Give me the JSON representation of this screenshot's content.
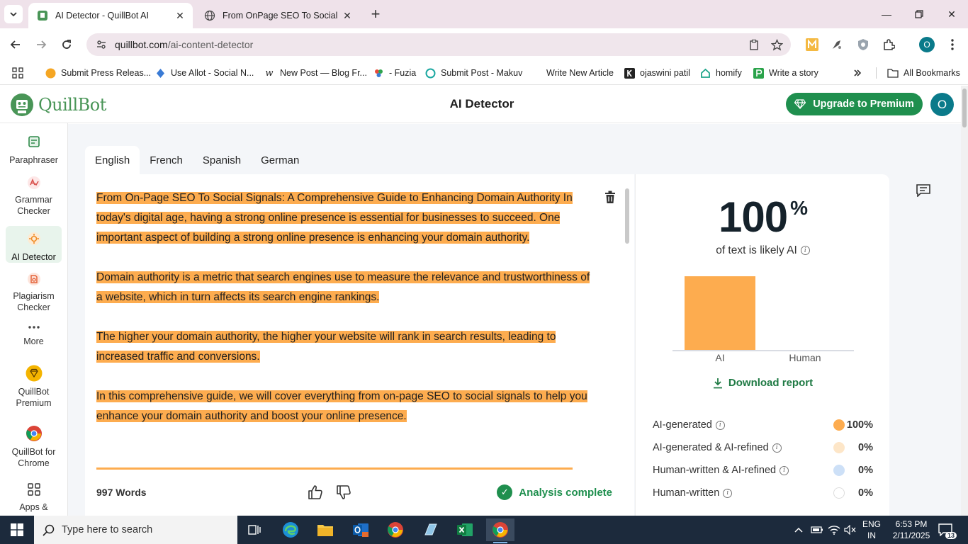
{
  "browser": {
    "tabs": [
      {
        "title": "AI Detector - QuillBot AI",
        "active": true
      },
      {
        "title": "From OnPage SEO To Social Sig",
        "active": false
      }
    ],
    "url_domain": "quillbot.com",
    "url_path": "/ai-content-detector",
    "bookmarks": [
      {
        "label": "Submit Press Releas...",
        "icon": "orange-circle-icon"
      },
      {
        "label": "Use Allot - Social N...",
        "icon": "allot-icon"
      },
      {
        "label": "New Post — Blog Fr...",
        "icon": "w-icon"
      },
      {
        "label": "- Fuzia",
        "icon": "fuzia-icon"
      },
      {
        "label": "Submit Post - Makuv",
        "icon": "makuv-icon"
      },
      {
        "label": "Write New Article",
        "icon": "blank-icon"
      },
      {
        "label": "ojaswini patil",
        "icon": "k-icon"
      },
      {
        "label": "homify",
        "icon": "homify-icon"
      },
      {
        "label": "Write a story",
        "icon": "p-icon"
      }
    ],
    "all_bookmarks_label": "All Bookmarks",
    "profile_initial": "O"
  },
  "app": {
    "logo_text": "QuillBot",
    "page_title": "AI Detector",
    "upgrade_label": "Upgrade to Premium",
    "avatar_initial": "O",
    "brand_color": "#499557",
    "highlight_color": "#fdac4f"
  },
  "sidebar": {
    "items": [
      {
        "label": "Paraphraser",
        "icon": "paraphraser-icon"
      },
      {
        "label": "Grammar Checker",
        "icon": "grammar-checker-icon"
      },
      {
        "label": "AI Detector",
        "icon": "ai-detector-icon",
        "active": true
      },
      {
        "label": "Plagiarism Checker",
        "icon": "plagiarism-checker-icon"
      },
      {
        "label": "More",
        "icon": "more-dots-icon"
      },
      {
        "label": "QuillBot Premium",
        "icon": "premium-gem-icon"
      },
      {
        "label": "QuillBot for Chrome",
        "icon": "chrome-icon"
      },
      {
        "label": "Apps &",
        "icon": "apps-grid-icon"
      }
    ]
  },
  "languages": [
    "English",
    "French",
    "Spanish",
    "German"
  ],
  "editor": {
    "paragraphs": [
      " From On-Page SEO To Social Signals: A Comprehensive Guide to Enhancing Domain Authority In today's digital age, having a strong online presence is essential for businesses to succeed. One important aspect of building a strong online presence is enhancing your domain authority.",
      "Domain authority is a metric that search engines use to measure the relevance and trustworthiness of a website, which in turn affects its search engine rankings.",
      "The higher your domain authority, the higher your website will rank in search results, leading to increased traffic and conversions.",
      "In this comprehensive guide, we will cover everything from on-page SEO to social signals to help you enhance your domain authority and boost your online presence."
    ],
    "word_count": "997 Words",
    "status": "Analysis complete"
  },
  "results": {
    "score": "100",
    "score_unit": "%",
    "score_caption": "of text is likely AI",
    "download_label": "Download report",
    "breakdown": [
      {
        "label": "AI-generated",
        "value": "100%",
        "color": "#fdac4f"
      },
      {
        "label": "AI-generated & AI-refined",
        "value": "0%",
        "color": "#fde6c8"
      },
      {
        "label": "Human-written & AI-refined",
        "value": "0%",
        "color": "#cde0f7"
      },
      {
        "label": "Human-written",
        "value": "0%",
        "color": "#ffffff"
      }
    ]
  },
  "chart_data": {
    "type": "bar",
    "categories": [
      "AI",
      "Human"
    ],
    "values": [
      100,
      0
    ],
    "ylim": [
      0,
      100
    ]
  },
  "taskbar": {
    "search_placeholder": "Type here to search",
    "lang_line1": "ENG",
    "lang_line2": "IN",
    "time": "6:53 PM",
    "date": "2/11/2025",
    "notification_count": "13"
  }
}
